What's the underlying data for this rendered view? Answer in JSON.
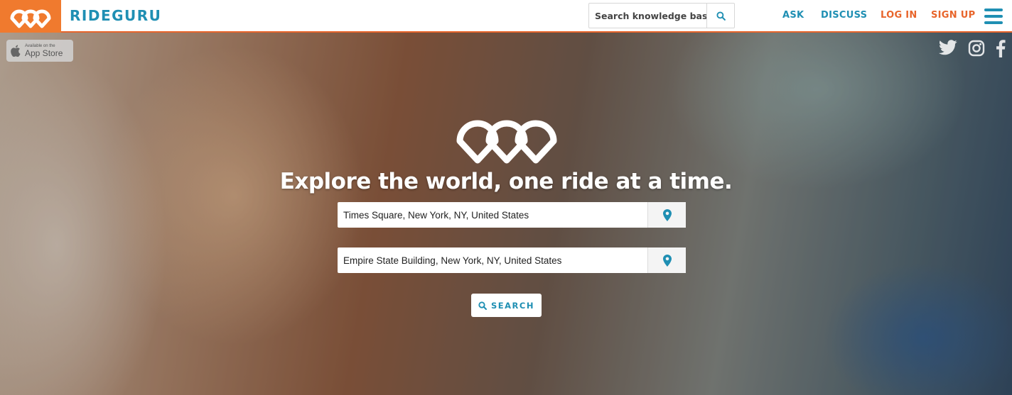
{
  "header": {
    "brand": "RIDEGURU",
    "search": {
      "placeholder": "Search knowledge base",
      "value": ""
    },
    "nav": {
      "ask": "ASK",
      "discuss": "DISCUSS",
      "login": "LOG IN",
      "signup": "SIGN UP"
    },
    "menu_icon": "hamburger-menu-icon"
  },
  "hero": {
    "app_store": {
      "small": "Available on the",
      "big": "App Store",
      "icon": "apple-icon"
    },
    "social": [
      "twitter-icon",
      "instagram-icon",
      "facebook-icon"
    ],
    "tagline": "Explore the world, one ride at a time.",
    "pickup": {
      "value": "Times Square, New York, NY, United States",
      "icon": "map-pin-icon"
    },
    "dropoff": {
      "value": "Empire State Building, New York, NY, United States",
      "icon": "map-pin-icon"
    },
    "search_button": {
      "label": "SEARCH",
      "icon": "search-icon"
    }
  },
  "colors": {
    "brand_blue": "#1f8fb3",
    "brand_orange": "#e8652b",
    "logo_bg": "#f07a2e"
  }
}
